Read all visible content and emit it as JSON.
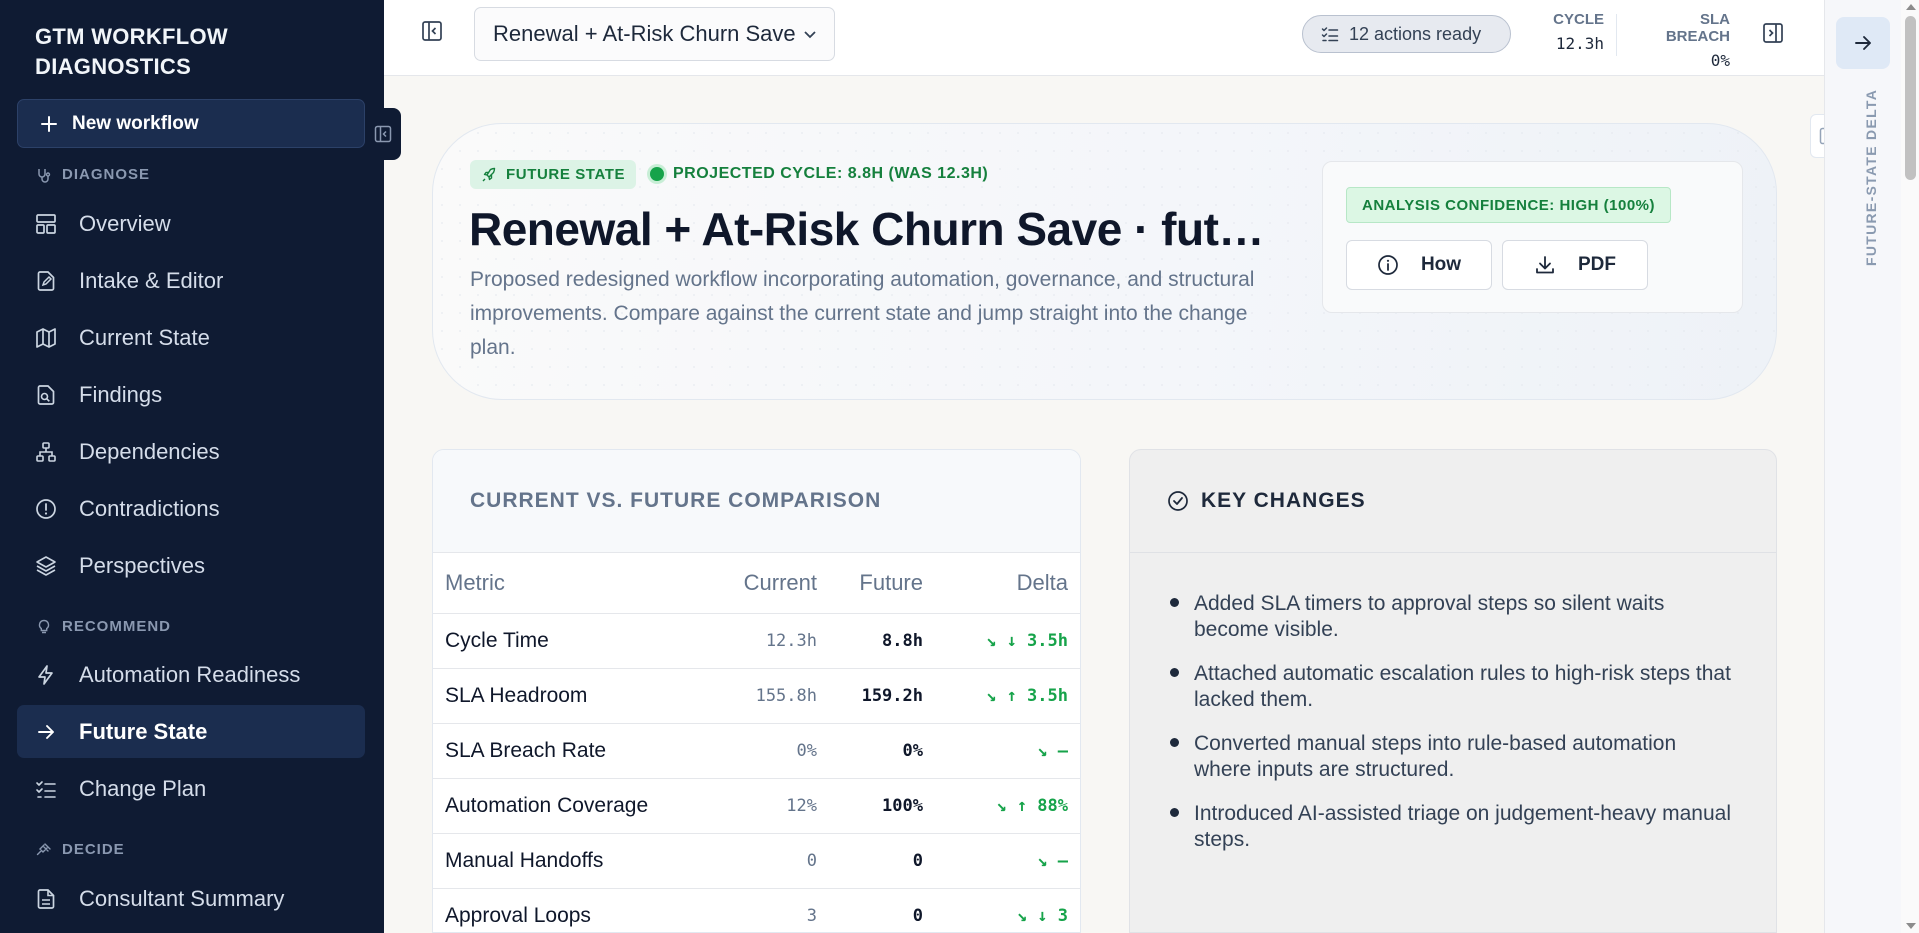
{
  "sidebar": {
    "brand": "GTM WORKFLOW DIAGNOSTICS",
    "new_workflow": "New workflow",
    "sections": {
      "diagnose": "DIAGNOSE",
      "recommend": "RECOMMEND",
      "decide": "DECIDE"
    },
    "items": [
      {
        "label": "Overview",
        "icon": "layout-icon"
      },
      {
        "label": "Intake & Editor",
        "icon": "file-edit-icon"
      },
      {
        "label": "Current State",
        "icon": "map-icon"
      },
      {
        "label": "Findings",
        "icon": "file-search-icon"
      },
      {
        "label": "Dependencies",
        "icon": "network-icon"
      },
      {
        "label": "Contradictions",
        "icon": "alert-circle-icon"
      },
      {
        "label": "Perspectives",
        "icon": "layers-icon"
      },
      {
        "label": "Automation Readiness",
        "icon": "zap-icon"
      },
      {
        "label": "Future State",
        "icon": "arrow-right-icon",
        "active": true
      },
      {
        "label": "Change Plan",
        "icon": "list-checks-icon"
      },
      {
        "label": "Consultant Summary",
        "icon": "document-icon"
      }
    ]
  },
  "topbar": {
    "workflow_select": "Renewal + At-Risk Churn Save",
    "actions_ready": "12 actions ready",
    "cycle_label": "CYCLE",
    "cycle_value": "12.3h",
    "sla_label": "SLA BREACH",
    "sla_value": "0%"
  },
  "rail": {
    "label": "FUTURE-STATE DELTA"
  },
  "hero": {
    "badge": "FUTURE STATE",
    "projected": "PROJECTED CYCLE: 8.8H (WAS 12.3H)",
    "title": "Renewal + At-Risk Churn Save · future state",
    "description": "Proposed redesigned workflow incorporating automation, governance, and structural improvements. Compare against the current state and jump straight into the change plan.",
    "confidence": "ANALYSIS CONFIDENCE: HIGH (100%)",
    "how_button": "How",
    "pdf_button": "PDF"
  },
  "comparison": {
    "title": "CURRENT VS. FUTURE COMPARISON",
    "columns": [
      "Metric",
      "Current",
      "Future",
      "Delta"
    ],
    "rows": [
      {
        "metric": "Cycle Time",
        "current": "12.3h",
        "future": "8.8h",
        "delta": "↘ ↓ 3.5h"
      },
      {
        "metric": "SLA Headroom",
        "current": "155.8h",
        "future": "159.2h",
        "delta": "↘ ↑ 3.5h"
      },
      {
        "metric": "SLA Breach Rate",
        "current": "0%",
        "future": "0%",
        "delta": "↘ —"
      },
      {
        "metric": "Automation Coverage",
        "current": "12%",
        "future": "100%",
        "delta": "↘ ↑ 88%"
      },
      {
        "metric": "Manual Handoffs",
        "current": "0",
        "future": "0",
        "delta": "↘ —"
      },
      {
        "metric": "Approval Loops",
        "current": "3",
        "future": "0",
        "delta": "↘ ↓ 3"
      }
    ]
  },
  "key_changes": {
    "title": "KEY CHANGES",
    "items": [
      "Added SLA timers to approval steps so silent waits become visible.",
      "Attached automatic escalation rules to high-risk steps that lacked them.",
      "Converted manual steps into rule-based automation where inputs are structured.",
      "Introduced AI-assisted triage on judgement-heavy manual steps."
    ]
  },
  "colors": {
    "sidebar_bg": "#0f1b33",
    "accent_green": "#16a34a",
    "text_dark": "#0f172a"
  }
}
